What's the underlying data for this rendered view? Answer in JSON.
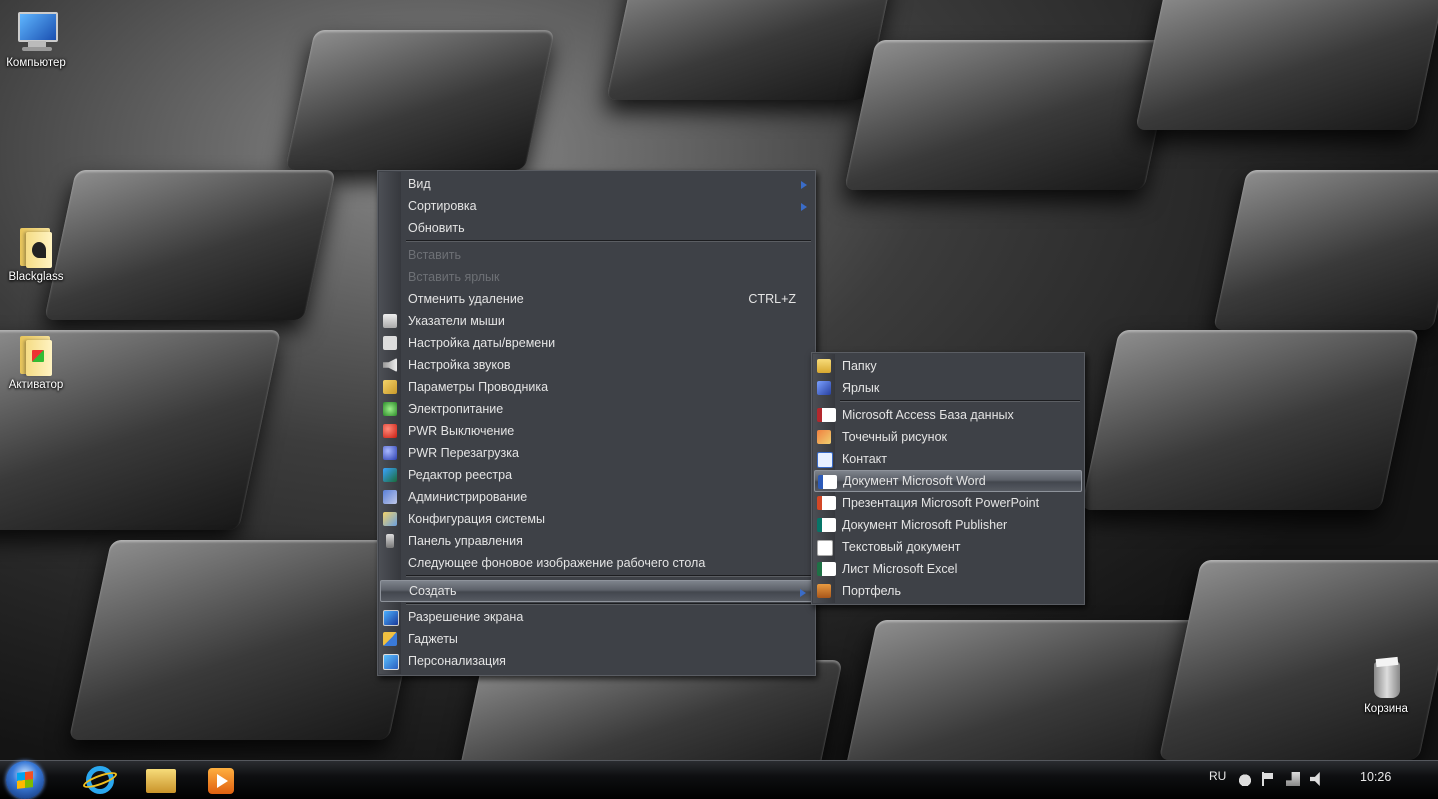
{
  "desktop": {
    "icons": [
      {
        "label": "Компьютер",
        "icon": "computer-icon"
      },
      {
        "label": "Blackglass",
        "icon": "folder-icon"
      },
      {
        "label": "Активатор",
        "icon": "folder-icon"
      },
      {
        "label": "Корзина",
        "icon": "recycle-bin-icon"
      }
    ]
  },
  "context_menu": {
    "items": [
      {
        "label": "Вид",
        "submenu": true
      },
      {
        "label": "Сортировка",
        "submenu": true
      },
      {
        "label": "Обновить"
      },
      {
        "label": "Вставить",
        "disabled": true
      },
      {
        "label": "Вставить ярлык",
        "disabled": true
      },
      {
        "label": "Отменить удаление",
        "shortcut": "CTRL+Z"
      },
      {
        "label": "Указатели мыши",
        "icon": "mouse-pointer-icon"
      },
      {
        "label": "Настройка даты/времени",
        "icon": "clock-icon"
      },
      {
        "label": "Настройка звуков",
        "icon": "speaker-icon"
      },
      {
        "label": "Параметры Проводника",
        "icon": "explorer-options-icon"
      },
      {
        "label": "Электропитание",
        "icon": "power-options-icon"
      },
      {
        "label": "PWR Выключение",
        "icon": "shutdown-icon"
      },
      {
        "label": "PWR Перезагрузка",
        "icon": "restart-icon"
      },
      {
        "label": "Редактор реестра",
        "icon": "registry-editor-icon"
      },
      {
        "label": "Администрирование",
        "icon": "administration-icon"
      },
      {
        "label": "Конфигурация системы",
        "icon": "system-config-icon"
      },
      {
        "label": "Панель управления",
        "icon": "control-panel-icon"
      },
      {
        "label": "Следующее фоновое изображение рабочего стола"
      },
      {
        "label": "Создать",
        "submenu": true,
        "highlighted": true
      },
      {
        "label": "Разрешение экрана",
        "icon": "display-icon"
      },
      {
        "label": "Гаджеты",
        "icon": "gadgets-icon"
      },
      {
        "label": "Персонализация",
        "icon": "personalization-icon"
      }
    ]
  },
  "create_submenu": {
    "items": [
      {
        "label": "Папку",
        "icon": "folder-icon"
      },
      {
        "label": "Ярлык",
        "icon": "shortcut-icon"
      },
      {
        "label": "Microsoft Access База данных",
        "icon": "access-icon"
      },
      {
        "label": "Точечный рисунок",
        "icon": "bitmap-icon"
      },
      {
        "label": "Контакт",
        "icon": "contact-icon"
      },
      {
        "label": "Документ Microsoft Word",
        "icon": "word-icon",
        "highlighted": true
      },
      {
        "label": "Презентация Microsoft PowerPoint",
        "icon": "powerpoint-icon"
      },
      {
        "label": "Документ Microsoft Publisher",
        "icon": "publisher-icon"
      },
      {
        "label": "Текстовый документ",
        "icon": "text-document-icon"
      },
      {
        "label": "Лист Microsoft Excel",
        "icon": "excel-icon"
      },
      {
        "label": "Портфель",
        "icon": "briefcase-icon"
      }
    ]
  },
  "taskbar": {
    "pinned": [
      "internet-explorer-icon",
      "windows-explorer-icon",
      "media-player-icon"
    ],
    "tray": {
      "language": "RU",
      "time": "10:26"
    }
  },
  "colors": {
    "menu_bg": "#3e4147",
    "highlight": "#5c6169",
    "submenu_arrow": "#3a6cc8"
  }
}
